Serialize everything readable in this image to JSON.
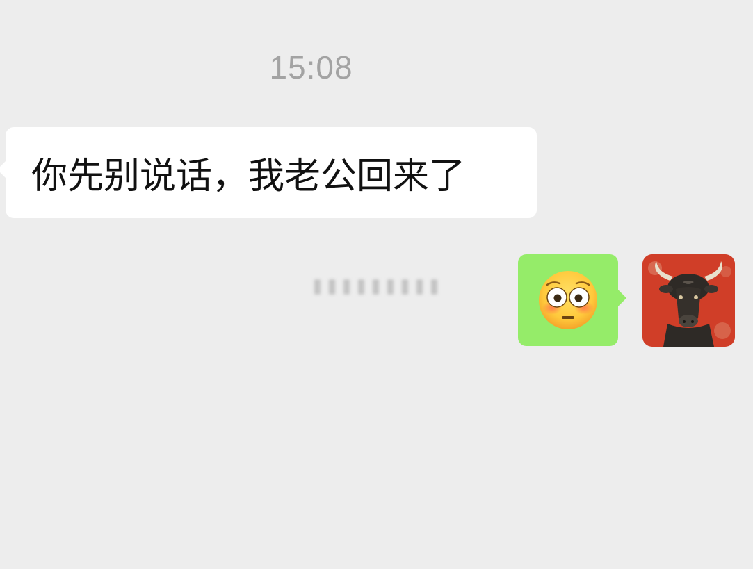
{
  "conversation": {
    "timestamp": "15:08",
    "messages": [
      {
        "direction": "incoming",
        "text": "你先别说话，我老公回来了"
      },
      {
        "direction": "outgoing",
        "type": "emoji",
        "emoji": "flushed-face-emoji"
      }
    ]
  },
  "avatar": {
    "icon": "bull-avatar",
    "background_color": "#d9432b"
  },
  "colors": {
    "chat_background": "#ededed",
    "incoming_bubble": "#ffffff",
    "outgoing_bubble": "#95ec69",
    "timestamp_text": "#a3a3a3"
  }
}
